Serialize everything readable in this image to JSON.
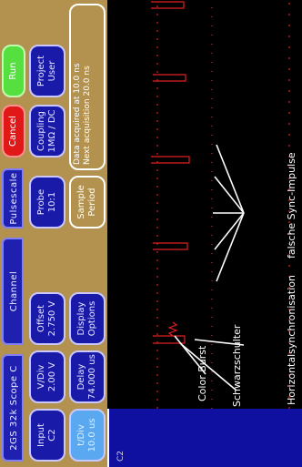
{
  "header": {
    "scope_label": "2GS 32k Scope C",
    "channel_label": "Channel",
    "pulsescale_label": "Pulsescale",
    "cancel_label": "Cancel",
    "run_label": "Run"
  },
  "buttons": {
    "input": {
      "line1": "Input",
      "line2": "C2"
    },
    "vdiv": {
      "line1": "V/Div",
      "line2": "2.00  V"
    },
    "offset": {
      "line1": "Offset",
      "line2": "2.750  V"
    },
    "probe": {
      "line1": "Probe",
      "line2": "10:1"
    },
    "coupling": {
      "line1": "Coupling",
      "line2": "1MΩ / DC"
    },
    "project_user": {
      "line1": "Project",
      "line2": "User"
    },
    "tdiv": {
      "line1": "t/Div",
      "line2": "10.0 us"
    },
    "delay": {
      "line1": "Delay",
      "line2": "74.000 us"
    },
    "display": {
      "line1": "Display",
      "line2": "Options"
    },
    "sample": {
      "line1": "Sample",
      "line2": "Period"
    },
    "acquire_info": {
      "line1": "Data acquired at 10.0 ns",
      "line2": "Next acquisition 20.0 ns"
    }
  },
  "channel_panel": {
    "label": "C2"
  },
  "annotations": {
    "schwarzschulter": "Schwarzschulter",
    "color_burst": "Color Burst",
    "horizontal_sync": "Horizontalsynchronisation",
    "false_sync": "falsche Sync-Impulse"
  },
  "colors": {
    "toolbar_bg": "#b3924f",
    "button_blue": "#1a1aa8",
    "trace_red": "#e02020",
    "cancel_red": "#e01818",
    "run_green": "#55e040"
  }
}
